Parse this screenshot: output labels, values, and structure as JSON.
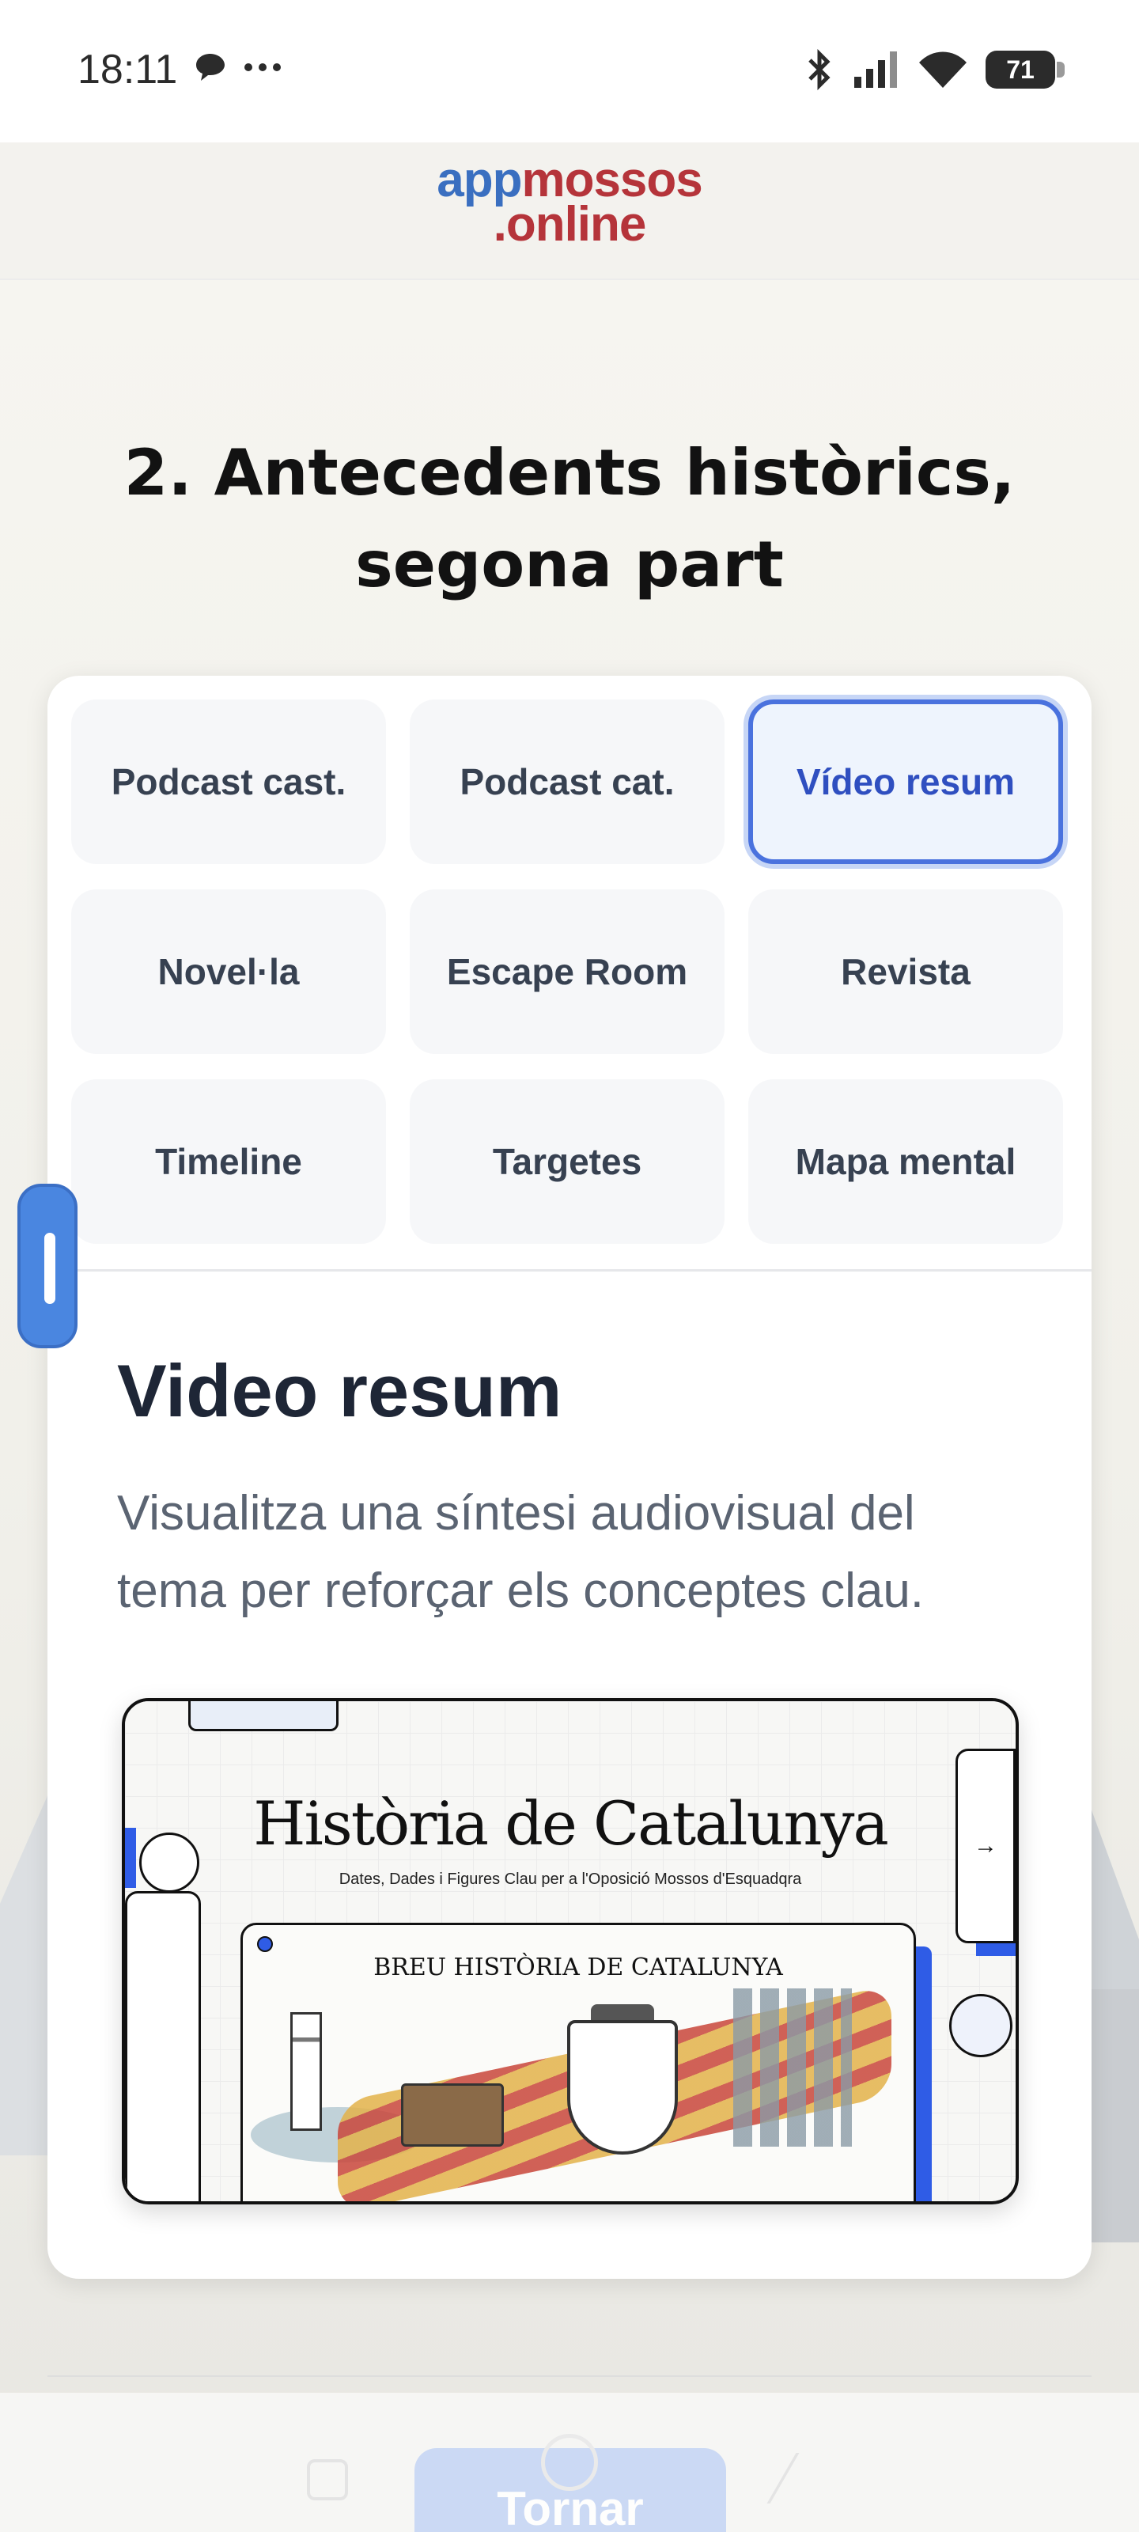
{
  "status_bar": {
    "time": "18:11",
    "notification_icons": [
      "chat-bubble-icon",
      "more-dots-icon"
    ],
    "system_icons": [
      "bluetooth-icon",
      "signal-icon",
      "wifi-icon"
    ],
    "battery": "71"
  },
  "header": {
    "logo_line1_part1": "app",
    "logo_line1_part2": "mossos",
    "logo_line2": ".online",
    "colors": {
      "blue": "#3a6fc0",
      "red": "#b5343a"
    }
  },
  "page": {
    "title": "2. Antecedents històrics, segona part"
  },
  "tabs": [
    {
      "label": "Podcast cast.",
      "active": false
    },
    {
      "label": "Podcast cat.",
      "active": false
    },
    {
      "label": "Vídeo resum",
      "active": true
    },
    {
      "label": "Novel·la",
      "active": false
    },
    {
      "label": "Escape Room",
      "active": false
    },
    {
      "label": "Revista",
      "active": false
    },
    {
      "label": "Timeline",
      "active": false
    },
    {
      "label": "Targetes",
      "active": false
    },
    {
      "label": "Mapa mental",
      "active": false
    }
  ],
  "section": {
    "title": "Video resum",
    "description": "Visualitza una síntesi audiovisual del tema per reforçar els conceptes clau."
  },
  "video": {
    "title": "Història de Catalunya",
    "subtitle": "Dates, Dades i Figures Clau per a l'Oposició Mossos d'Esquadqra",
    "inner_title": "BREU HISTÒRIA DE CATALUNYA",
    "arrow": "→",
    "accent": "#2f5ce6"
  },
  "bottom": {
    "back_label": "Tornar"
  }
}
